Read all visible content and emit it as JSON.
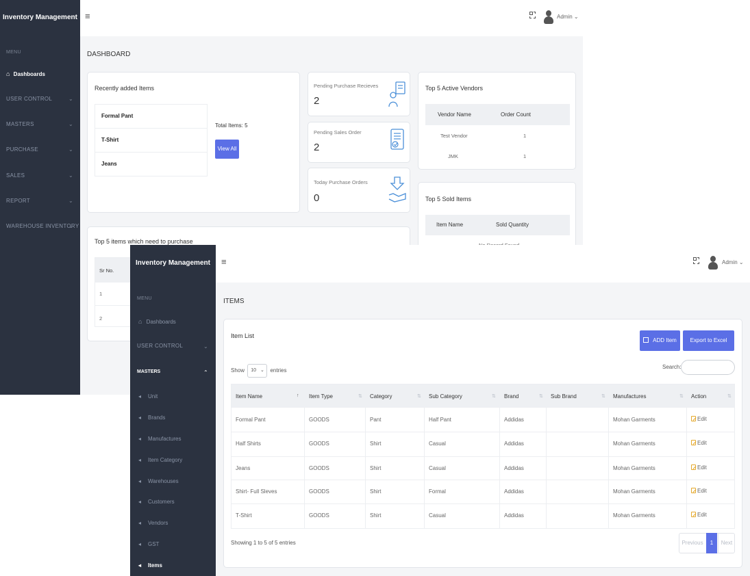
{
  "screen1": {
    "sidebar": {
      "brand": "Inventory Management",
      "menu_label": "MENU",
      "items": [
        {
          "label": "Dashboards",
          "active": true
        },
        {
          "label": "USER CONTROL"
        },
        {
          "label": "MASTERS"
        },
        {
          "label": "PURCHASE"
        },
        {
          "label": "SALES"
        },
        {
          "label": "REPORT"
        },
        {
          "label": "WAREHOUSE INVENTORY"
        }
      ]
    },
    "topbar": {
      "menu_icon": "≡",
      "user": "Admin"
    },
    "page_title": "DASHBOARD",
    "recent": {
      "title": "Recently added Items",
      "items": [
        "Formal Pant",
        "T-Shirt",
        "Jeans"
      ],
      "total_label": "Total Items:",
      "total_value": "5",
      "view_all": "View All"
    },
    "stats": [
      {
        "label": "Pending Purchase Recieves",
        "value": "2",
        "icon": "purchase-receive-icon"
      },
      {
        "label": "Pending Sales Order",
        "value": "2",
        "icon": "sales-order-icon"
      },
      {
        "label": "Today Purchase Orders",
        "value": "0",
        "icon": "purchase-order-icon"
      }
    ],
    "vendors": {
      "title": "Top 5 Active Vendors",
      "columns": [
        "Vendor Name",
        "Order Count"
      ],
      "rows": [
        [
          "Test Vendor",
          "1"
        ],
        [
          "JMK",
          "1"
        ]
      ]
    },
    "sold": {
      "title": "Top 5 Sold Items",
      "columns": [
        "Item Name",
        "Sold Quantity"
      ],
      "empty": "No Record Found"
    },
    "need_purchase": {
      "title": "Top 5 items which need to purchase",
      "column": "Sr No.",
      "rows": [
        "1",
        "2"
      ]
    }
  },
  "screen2": {
    "sidebar": {
      "brand": "Inventory Management",
      "menu_label": "MENU",
      "dashboards": "Dashboards",
      "user_control": "USER CONTROL",
      "masters": "MASTERS",
      "sub_items": [
        "Unit",
        "Brands",
        "Manufactures",
        "Item Category",
        "Warehouses",
        "Customers",
        "Vendors",
        "GST",
        "Items"
      ]
    },
    "topbar": {
      "menu_icon": "≡",
      "user": "Admin"
    },
    "page_title": "ITEMS",
    "card_title": "Item List",
    "add_button": "ADD Item",
    "export_button": "Export to Excel",
    "show_label": "Show",
    "page_size": "10",
    "entries_label": "entries",
    "search_label": "Search:",
    "search_value": "",
    "columns": [
      "Item Name",
      "Item Type",
      "Category",
      "Sub Category",
      "Brand",
      "Sub Brand",
      "Manufactures",
      "Action"
    ],
    "rows": [
      [
        "Formal Pant",
        "GOODS",
        "Pant",
        "Half Pant",
        "Addidas",
        "",
        "Mohan Garments",
        "Edit"
      ],
      [
        "Half Shirts",
        "GOODS",
        "Shirt",
        "Casual",
        "Addidas",
        "",
        "Mohan Garments",
        "Edit"
      ],
      [
        "Jeans",
        "GOODS",
        "Shirt",
        "Casual",
        "Addidas",
        "",
        "Mohan Garments",
        "Edit"
      ],
      [
        "Shirt- Full Sleves",
        "GOODS",
        "Shirt",
        "Formal",
        "Addidas",
        "",
        "Mohan Garments",
        "Edit"
      ],
      [
        "T-Shirt",
        "GOODS",
        "Shirt",
        "Casual",
        "Addidas",
        "",
        "Mohan Garments",
        "Edit"
      ]
    ],
    "showing": "Showing 1 to 5 of 5 entries",
    "pagination": {
      "previous": "Previous",
      "current": "1",
      "next": "Next"
    },
    "colors": {
      "primary": "#5b6fe6",
      "sidebar": "#2b3240",
      "edit": "#e4a82b"
    }
  }
}
